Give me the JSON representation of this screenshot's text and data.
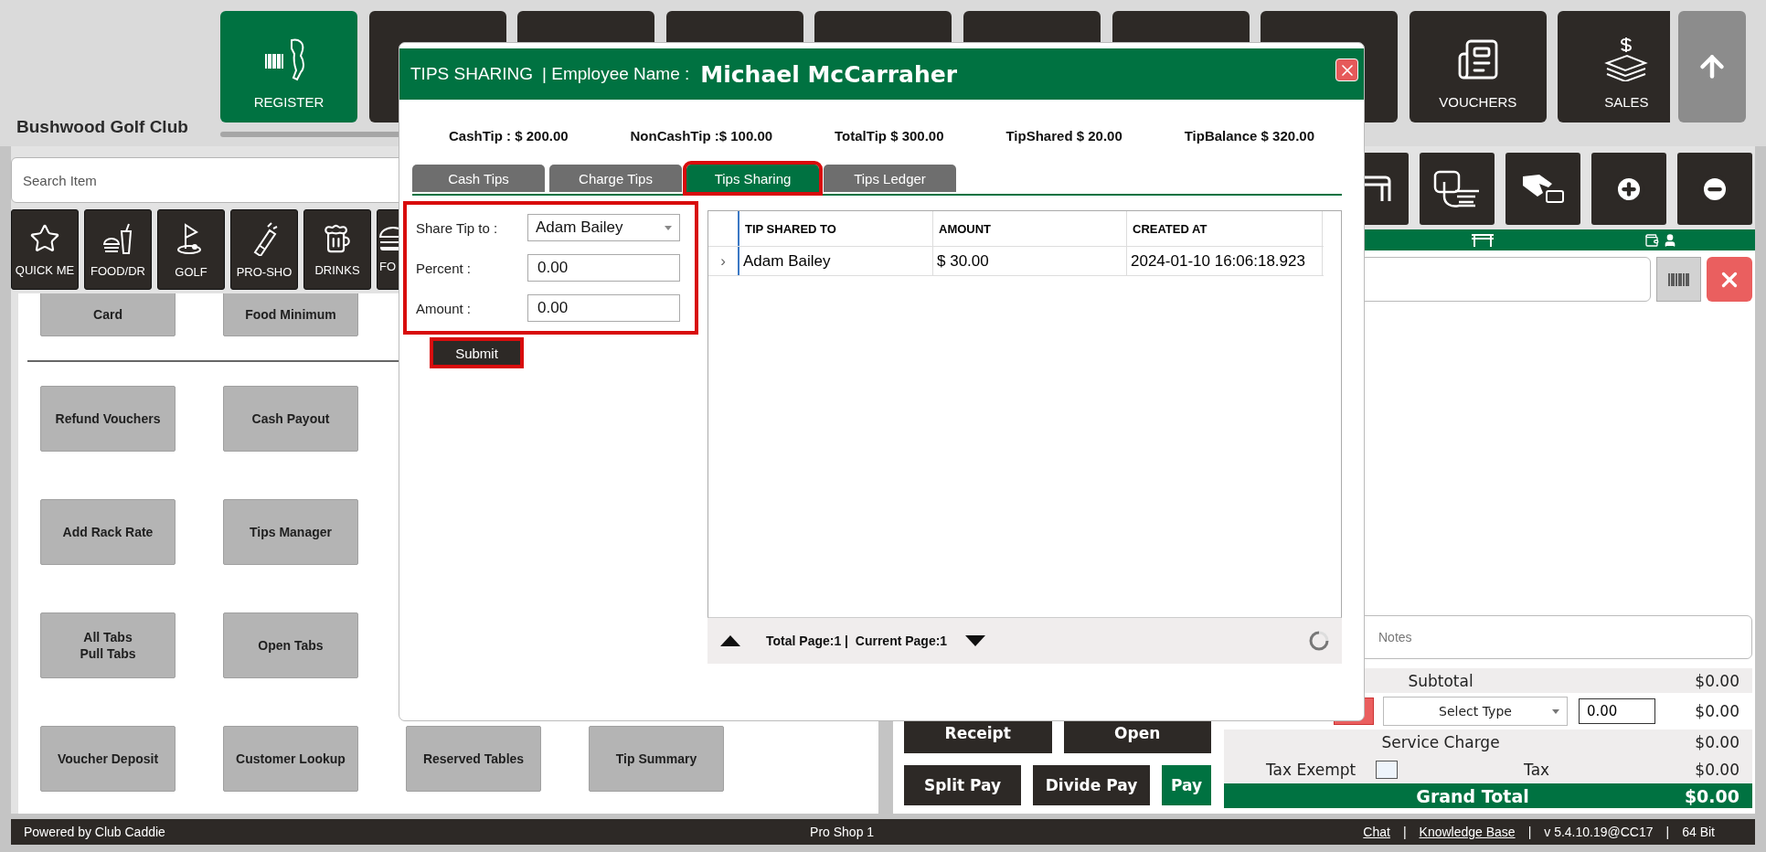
{
  "header": {
    "club_name": "Bushwood Golf Club",
    "nav_buttons": [
      {
        "kind": "register",
        "label": "REGISTER",
        "selected": true
      },
      {
        "kind": "blank",
        "selected": false
      },
      {
        "kind": "blank",
        "selected": false
      },
      {
        "kind": "blank",
        "selected": false
      },
      {
        "kind": "blank",
        "selected": false
      },
      {
        "kind": "blank",
        "selected": false
      },
      {
        "kind": "blank",
        "selected": false
      },
      {
        "kind": "blank",
        "selected": false
      },
      {
        "kind": "vouchers",
        "label": "VOUCHERS",
        "selected": false
      },
      {
        "kind": "sales",
        "label": "SALES",
        "selected": false
      }
    ]
  },
  "search": {
    "placeholder": "Search Item"
  },
  "categories": [
    {
      "kind": "star",
      "label": "QUICK ME"
    },
    {
      "kind": "food",
      "label": "FOOD/DR"
    },
    {
      "kind": "golf",
      "label": "GOLF"
    },
    {
      "kind": "bag",
      "label": "PRO-SHO"
    },
    {
      "kind": "beer",
      "label": "DRINKS"
    },
    {
      "kind": "burger",
      "label": "FO"
    }
  ],
  "partial_tiles": [
    "Card",
    "Food Minimum"
  ],
  "tile_rows": [
    [
      "Refund Vouchers",
      "Cash Payout"
    ],
    [
      "Add Rack Rate",
      "Tips Manager"
    ],
    [
      "All Tabs\nPull Tabs",
      "Open Tabs"
    ],
    [
      "Voucher Deposit",
      "Customer Lookup",
      "Reserved Tables",
      "Tip Summary"
    ]
  ],
  "order": {
    "notes_placeholder": "Notes"
  },
  "totals": {
    "subtotal": {
      "label": "Subtotal",
      "value": "$0.00"
    },
    "discount": {
      "type": "Select Type",
      "amount": "0.00",
      "value": "$0.00"
    },
    "service_charge": {
      "label": "Service Charge",
      "value": "$0.00"
    },
    "tax_exempt": {
      "label": "Tax Exempt",
      "checked": false
    },
    "tax": {
      "label": "Tax",
      "value": "$0.00"
    },
    "grand_total": {
      "label": "Grand Total",
      "value": "$0.00"
    }
  },
  "actions": [
    [
      {
        "label": "Receipt",
        "kind": "dark"
      },
      {
        "label": "Open",
        "kind": "dark"
      }
    ],
    [
      {
        "label": "Split Pay",
        "kind": "dark"
      },
      {
        "label": "Divide Pay",
        "kind": "dark"
      },
      {
        "label": "Pay",
        "kind": "primary"
      }
    ]
  ],
  "footer": {
    "separator": "|",
    "left": "Powered by Club Caddie",
    "center": "Pro Shop 1",
    "links": [
      "Chat",
      "Knowledge Base"
    ],
    "version": "v 5.4.10.19@CC17",
    "bits": "64 Bit"
  },
  "dialog": {
    "title": "TIPS SHARING",
    "employee_label": "| Employee Name :",
    "employee_name": "Michael McCarraher",
    "stats": [
      "CashTip : $ 200.00",
      "NonCashTip :$ 100.00",
      "TotalTip $ 300.00",
      "TipShared $ 20.00",
      "TipBalance $ 320.00"
    ],
    "tabs": [
      {
        "label": "Cash Tips",
        "selected": false,
        "highlighted": false
      },
      {
        "label": "Charge Tips",
        "selected": false,
        "highlighted": false
      },
      {
        "label": "Tips Sharing",
        "selected": true,
        "highlighted": true
      },
      {
        "label": "Tips Ledger",
        "selected": false,
        "highlighted": false
      }
    ],
    "form": {
      "highlighted": true,
      "share_label": "Share Tip to :",
      "share_value": "Adam Bailey",
      "percent_label": "Percent :",
      "percent_value": "0.00",
      "amount_label": "Amount :",
      "amount_value": "0.00"
    },
    "submit": {
      "label": "Submit",
      "highlighted": true
    },
    "table": {
      "columns": [
        "TIP SHARED TO",
        "AMOUNT",
        "CREATED AT"
      ],
      "rows": [
        {
          "expander": "›",
          "cells": [
            "Adam Bailey",
            "$ 30.00",
            "2024-01-10 16:06:18.923"
          ]
        }
      ]
    },
    "pager": {
      "text": "Total Page:1 |  Current Page:1"
    }
  }
}
